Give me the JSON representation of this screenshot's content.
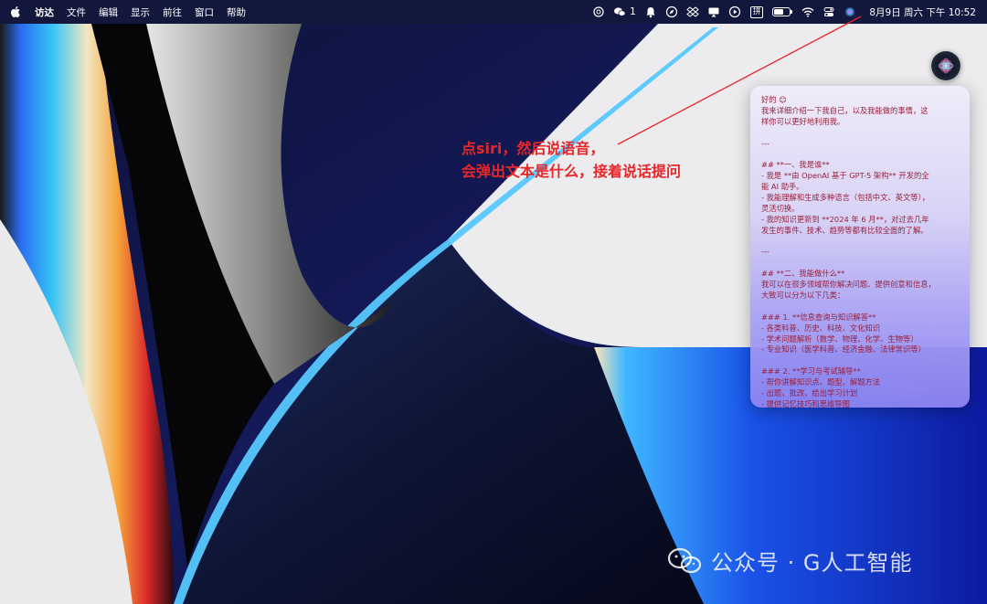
{
  "menubar": {
    "app_name": "访达",
    "menus": [
      "文件",
      "编辑",
      "显示",
      "前往",
      "窗口",
      "帮助"
    ],
    "wechat_count": "1",
    "input_method": "拼",
    "datetime": "8月9日 周六 下午 10:52",
    "status_icons": [
      "chatgpt-icon",
      "wechat-icon",
      "notification-icon",
      "navigation-icon",
      "dropbox-icon",
      "screen-mirroring-icon",
      "play-icon",
      "input-method-icon",
      "battery-icon",
      "wifi-icon",
      "control-center-icon",
      "siri-icon"
    ],
    "battery_level": 0.6
  },
  "siri": {
    "response_lines": [
      "好的 😊",
      "我来详细介绍一下我自己，以及我能做的事情，这",
      "样你可以更好地利用我。",
      "",
      "---",
      "",
      "## **一、我是谁**",
      "- 我是 **由 OpenAI 基于 GPT-5 架构** 开发的全",
      "能 AI 助手。",
      "- 我能理解和生成多种语言（包括中文、英文等），",
      "灵活切换。",
      "- 我的知识更新到 **2024 年 6 月**，对过去几年",
      "发生的事件、技术、趋势等都有比较全面的了解。",
      "",
      "---",
      "",
      "## **二、我能做什么**",
      "我可以在很多领域帮你解决问题、提供创意和信息，",
      "大致可以分为以下几类：",
      "",
      "### 1. **信息查询与知识解答**",
      "- 各类科普、历史、科技、文化知识",
      "- 学术问题解析（数学、物理、化学、生物等）",
      "- 专业知识（医学科普、经济金融、法律常识等）",
      "",
      "### 2. **学习与考试辅导**",
      "- 帮你讲解知识点、题型、解题方法",
      "- 出题、批改、给出学习计划",
      "- 提供记忆技巧和思维导图"
    ]
  },
  "annotation": {
    "line1": "点siri，然后说语音，",
    "line2": "会弹出文本是什么，接着说话提问",
    "color": "#e8262a"
  },
  "watermark": {
    "text": "公众号 · G人工智能"
  }
}
